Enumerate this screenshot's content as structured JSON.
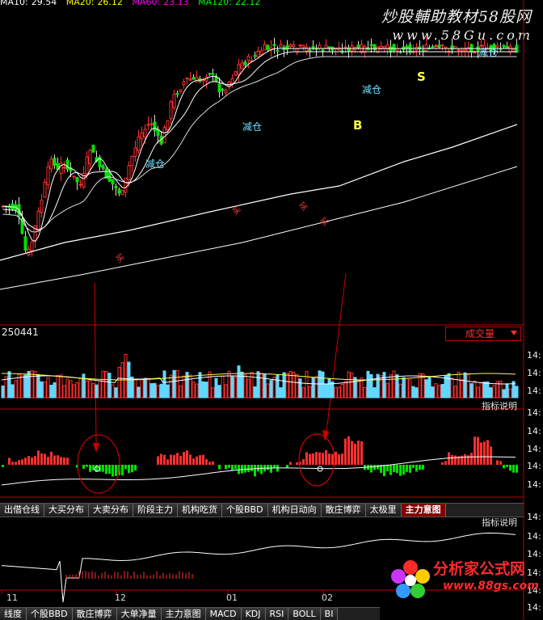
{
  "header": {
    "ma_legend": [
      {
        "label": "MA10:",
        "value": "29.54",
        "color": "#ffffff"
      },
      {
        "label": "MA20:",
        "value": "26.12",
        "color": "#ffff00"
      },
      {
        "label": "MA60:",
        "value": "23.13",
        "color": "#ff00ff"
      },
      {
        "label": "MA120:",
        "value": "22.12",
        "color": "#00ff00"
      }
    ],
    "watermark_title": "炒股輔助教材58股网",
    "watermark_url": "www.58Gu.com"
  },
  "signals": {
    "reduce_label": "减仓",
    "buy_label": "买",
    "B": "B",
    "S": "S"
  },
  "volume_panel": {
    "value_label": "250441",
    "dropdown": "成交量",
    "note": "指标说明"
  },
  "indicator_panel": {
    "note": "指标说明"
  },
  "tabs": [
    "出借仓线",
    "大买分布",
    "大卖分布",
    "阶段主力",
    "机构吃货",
    "个股BBD",
    "机构日动向",
    "散庄博弈",
    "太极里",
    "主力意图"
  ],
  "active_tab": "主力意图",
  "bottom_panel": {
    "note": "指标说明"
  },
  "right_axis_label": "14:",
  "x_axis": [
    "11",
    "12",
    "01",
    "02"
  ],
  "bottom_tabs": [
    "线度",
    "个股BBD",
    "散庄博弈",
    "大单净量",
    "主力意图",
    "MACD",
    "KDJ",
    "RSI",
    "BOLL",
    "BI"
  ],
  "logo": {
    "cn": "分析家公式网",
    "url": "www.88gs.com"
  },
  "colors": {
    "up": "#ff3030",
    "down": "#00e000",
    "vol_up": "#ff3030",
    "vol_down": "#60d8ff"
  },
  "chart_data": [
    {
      "type": "candlestick",
      "series_names": [
        "MA10",
        "MA20",
        "MA60",
        "MA120"
      ],
      "annotations": [
        "减仓",
        "减仓",
        "减仓",
        "减仓",
        "买",
        "买",
        "买",
        "买",
        "B",
        "S"
      ]
    },
    {
      "type": "bar",
      "title": "成交量"
    },
    {
      "type": "bar",
      "title": "主力意图"
    },
    {
      "type": "line"
    }
  ]
}
